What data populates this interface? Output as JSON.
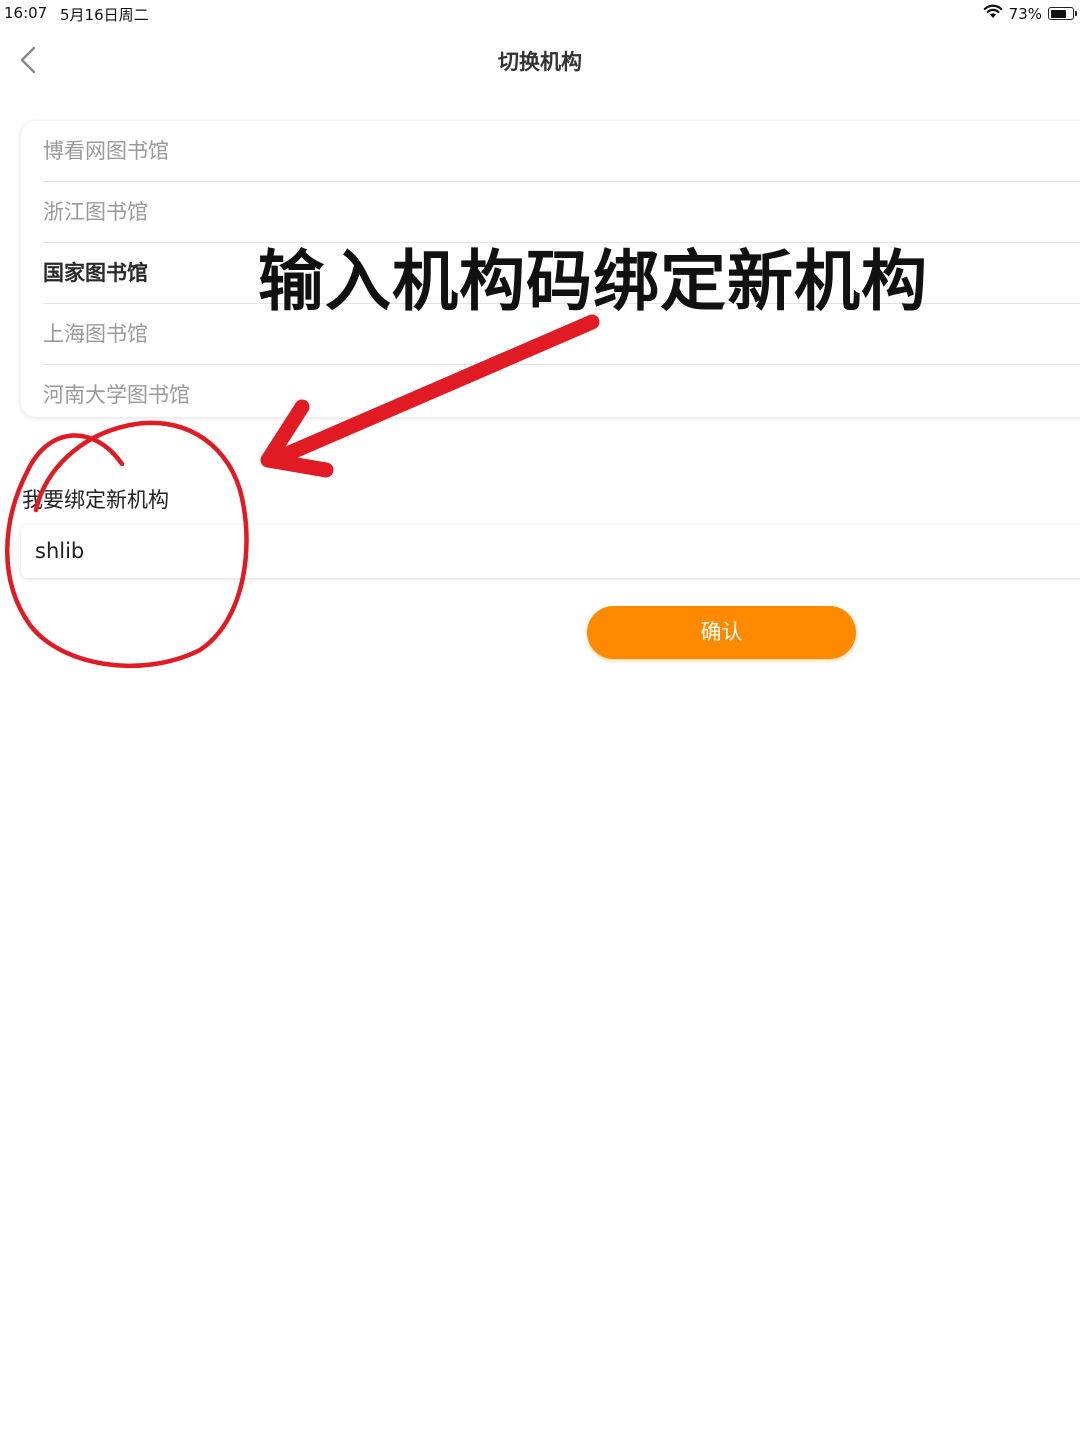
{
  "status_bar": {
    "time": "16:07",
    "date": "5月16日周二",
    "battery_percent": "73%",
    "battery_level": 0.73
  },
  "nav": {
    "title": "切换机构",
    "back_icon": "chevron-left-icon"
  },
  "organizations": [
    {
      "name": "博看网图书馆",
      "selected": false
    },
    {
      "name": "浙江图书馆",
      "selected": false
    },
    {
      "name": "国家图书馆",
      "selected": true
    },
    {
      "name": "上海图书馆",
      "selected": false
    },
    {
      "name": "河南大学图书馆",
      "selected": false
    }
  ],
  "bind": {
    "label": "我要绑定新机构",
    "input_value": "shlib",
    "confirm_label": "确认"
  },
  "annotation": {
    "text": "输入机构码绑定新机构",
    "color": "#e01b24"
  },
  "colors": {
    "accent": "#ff8a00",
    "annotation": "#e01b24"
  }
}
